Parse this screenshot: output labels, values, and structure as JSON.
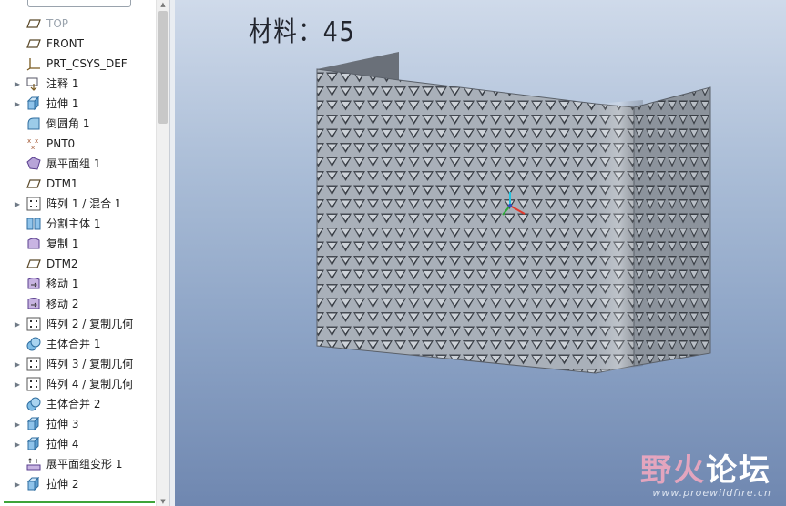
{
  "model_tree": {
    "items": [
      {
        "label": "TOP",
        "icon": "datum-plane-icon",
        "expandable": false,
        "dim": true
      },
      {
        "label": "FRONT",
        "icon": "datum-plane-icon",
        "expandable": false
      },
      {
        "label": "PRT_CSYS_DEF",
        "icon": "coordinate-system-icon",
        "expandable": false
      },
      {
        "label": "注释 1",
        "icon": "annotation-icon",
        "expandable": true
      },
      {
        "label": "拉伸 1",
        "icon": "extrude-icon",
        "expandable": true
      },
      {
        "label": "倒圆角 1",
        "icon": "round-icon",
        "expandable": false
      },
      {
        "label": "PNT0",
        "icon": "datum-point-icon",
        "expandable": false
      },
      {
        "label": "展平面组 1",
        "icon": "flatten-quilt-icon",
        "expandable": false
      },
      {
        "label": "DTM1",
        "icon": "datum-plane-icon",
        "expandable": false
      },
      {
        "label": "阵列 1 / 混合 1",
        "icon": "pattern-icon",
        "expandable": true
      },
      {
        "label": "分割主体 1",
        "icon": "split-body-icon",
        "expandable": false
      },
      {
        "label": "复制 1",
        "icon": "copy-icon",
        "expandable": false
      },
      {
        "label": "DTM2",
        "icon": "datum-plane-icon",
        "expandable": false
      },
      {
        "label": "移动 1",
        "icon": "move-icon",
        "expandable": false
      },
      {
        "label": "移动 2",
        "icon": "move-icon",
        "expandable": false
      },
      {
        "label": "阵列 2 / 复制几何",
        "icon": "pattern-icon",
        "expandable": true
      },
      {
        "label": "主体合并 1",
        "icon": "body-merge-icon",
        "expandable": false
      },
      {
        "label": "阵列 3 / 复制几何",
        "icon": "pattern-icon",
        "expandable": true
      },
      {
        "label": "阵列 4 / 复制几何",
        "icon": "pattern-icon",
        "expandable": true
      },
      {
        "label": "主体合并 2",
        "icon": "body-merge-icon",
        "expandable": false
      },
      {
        "label": "拉伸 3",
        "icon": "extrude-icon",
        "expandable": true
      },
      {
        "label": "拉伸 4",
        "icon": "extrude-icon",
        "expandable": true
      },
      {
        "label": "展平面组变形 1",
        "icon": "flatten-quilt-deform-icon",
        "expandable": false
      },
      {
        "label": "拉伸 2",
        "icon": "extrude-icon",
        "expandable": true
      }
    ]
  },
  "viewport": {
    "note": "材料：45",
    "part_color": "#8e959f",
    "background_top": "#cfdaea",
    "background_bottom": "#6f87b0"
  },
  "watermark": {
    "part1": "野火",
    "part2": "论坛",
    "url": "www.proewildfire.cn"
  }
}
